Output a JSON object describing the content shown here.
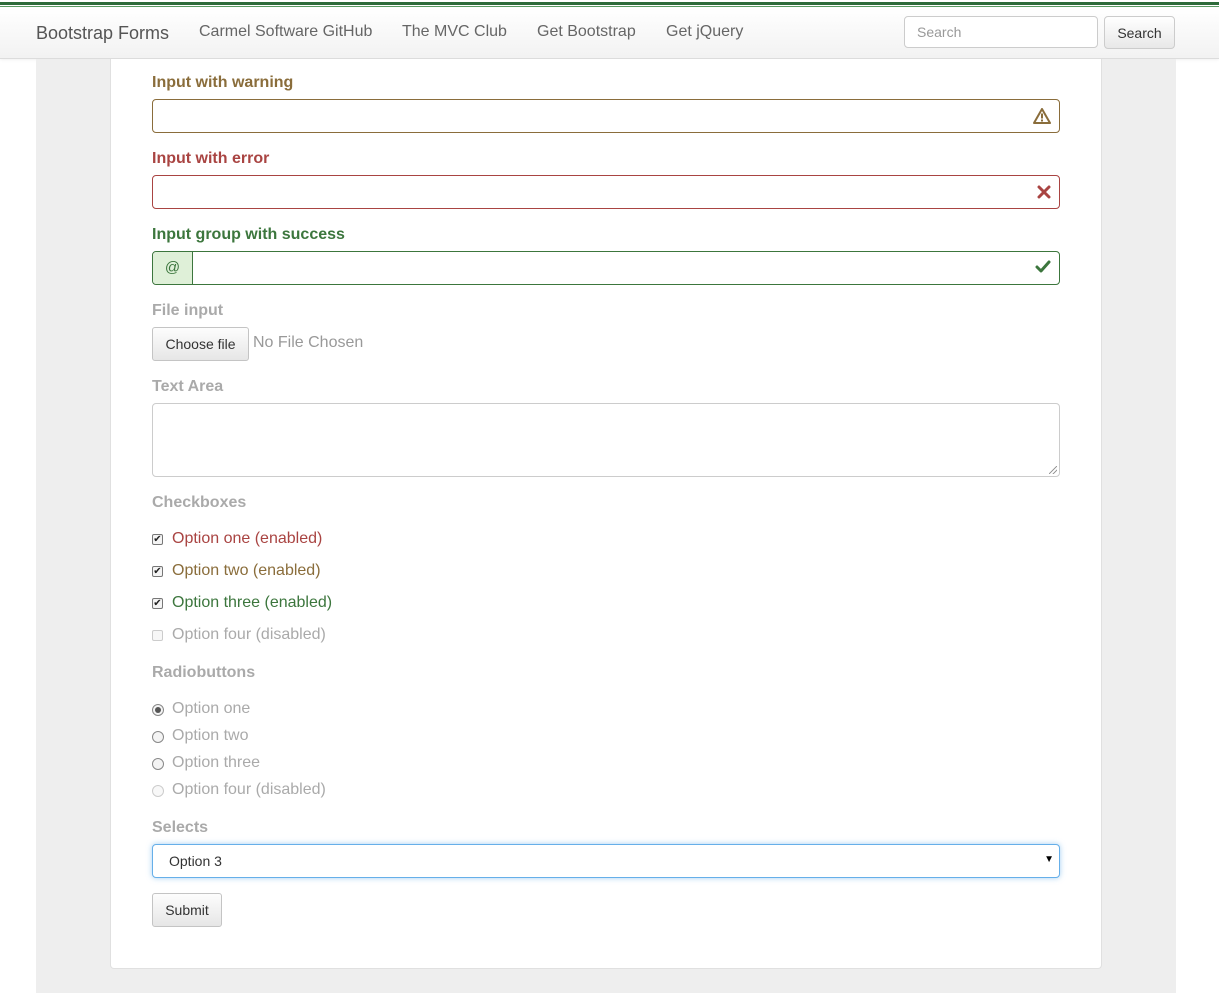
{
  "navbar": {
    "brand": "Bootstrap Forms",
    "links": [
      "Carmel Software GitHub",
      "The MVC Club",
      "Get Bootstrap",
      "Get jQuery"
    ],
    "search_placeholder": "Search",
    "search_button": "Search"
  },
  "form": {
    "warning": {
      "label": "Input with warning",
      "icon": "warning-triangle-icon"
    },
    "error": {
      "label": "Input with error",
      "icon": "remove-x-icon"
    },
    "success": {
      "label": "Input group with success",
      "addon": "@",
      "icon": "checkmark-icon"
    },
    "file": {
      "label": "File input",
      "button": "Choose file",
      "status": "No File Chosen"
    },
    "textarea": {
      "label": "Text Area"
    },
    "checkboxes": {
      "label": "Checkboxes",
      "items": [
        {
          "text": "Option one (enabled)",
          "checked": true,
          "color": "#a94442"
        },
        {
          "text": "Option two (enabled)",
          "checked": true,
          "color": "#8a6d3b"
        },
        {
          "text": "Option three (enabled)",
          "checked": true,
          "color": "#3c763d"
        },
        {
          "text": "Option four (disabled)",
          "checked": false,
          "disabled": true,
          "color": "#aaaaaa"
        }
      ]
    },
    "radios": {
      "label": "Radiobuttons",
      "items": [
        {
          "text": "Option one",
          "checked": true
        },
        {
          "text": "Option two",
          "checked": false
        },
        {
          "text": "Option three",
          "checked": false
        },
        {
          "text": "Option four (disabled)",
          "checked": false,
          "disabled": true
        }
      ]
    },
    "select": {
      "label": "Selects",
      "value": "Option 3"
    },
    "submit": "Submit"
  },
  "colors": {
    "warning": "#8a6d3b",
    "error": "#a94442",
    "success": "#3c763d",
    "muted": "#aaaaaa",
    "focus": "#66afe9"
  }
}
